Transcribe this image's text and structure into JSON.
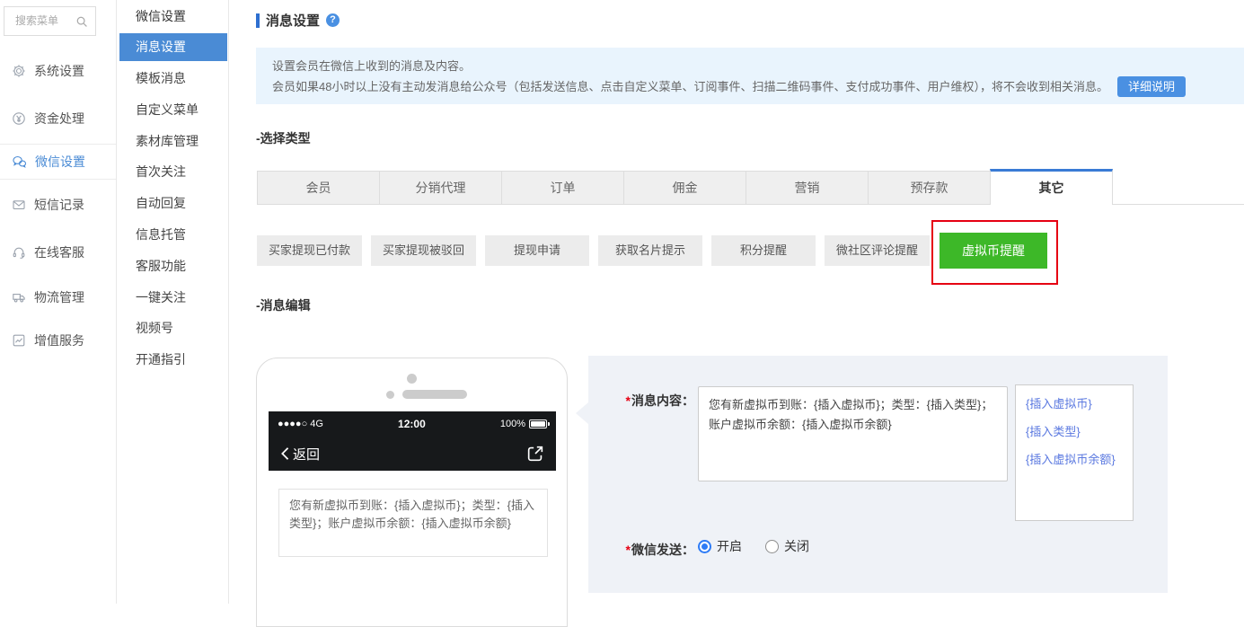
{
  "colors": {
    "accent_blue": "#4a8bd5",
    "tab_active_border": "#3a7bd5",
    "notice_bg": "#e9f4fd",
    "highlight_green": "#3db828",
    "annotation_red": "#e60012",
    "insert_link_blue": "#5b79e0"
  },
  "sidebar": {
    "search_placeholder": "搜索菜单",
    "items": [
      {
        "label": "系统设置",
        "icon": "gear-icon"
      },
      {
        "label": "资金处理",
        "icon": "yen-circle-icon"
      },
      {
        "label": "微信设置",
        "icon": "wechat-icon",
        "active": true
      },
      {
        "label": "短信记录",
        "icon": "envelope-icon"
      },
      {
        "label": "在线客服",
        "icon": "headset-icon"
      },
      {
        "label": "物流管理",
        "icon": "truck-icon"
      },
      {
        "label": "增值服务",
        "icon": "chart-icon"
      }
    ]
  },
  "submenu": {
    "title": "微信设置",
    "active_item": "消息设置",
    "items": [
      "消息设置",
      "模板消息",
      "自定义菜单",
      "素材库管理",
      "首次关注",
      "自动回复",
      "信息托管",
      "客服功能",
      "一键关注",
      "视频号",
      "开通指引"
    ]
  },
  "main": {
    "page_title": "消息设置",
    "help_icon_glyph": "?",
    "notice": {
      "line1": "设置会员在微信上收到的消息及内容。",
      "line2": "会员如果48小时以上没有主动发消息给公众号（包括发送信息、点击自定义菜单、订阅事件、扫描二维码事件、支付成功事件、用户维权），将不会收到相关消息。",
      "detail_button": "详细说明"
    },
    "select_type_label": "-选择类型",
    "tabs": [
      "会员",
      "分销代理",
      "订单",
      "佣金",
      "营销",
      "预存款",
      "其它"
    ],
    "active_tab": "其它",
    "type_buttons": [
      "买家提现已付款",
      "买家提现被驳回",
      "提现申请",
      "获取名片提示",
      "积分提醒",
      "微社区评论提醒"
    ],
    "highlighted_type_button": "虚拟币提醒",
    "message_edit_label": "-消息编辑"
  },
  "phone": {
    "status_signal": "●●●●○ 4G",
    "status_time": "12:00",
    "status_battery": "100%",
    "back_label": "返回",
    "preview_message": "您有新虚拟币到账：{插入虚拟币}；类型：{插入类型}；账户虚拟币余额：{插入虚拟币余额}"
  },
  "form": {
    "required_mark": "*",
    "message_content_label": "消息内容：",
    "message_content_value": "您有新虚拟币到账：{插入虚拟币}；类型：{插入类型}；账户虚拟币余额：{插入虚拟币余额}",
    "insert_links": [
      "{插入虚拟币}",
      "{插入类型}",
      "{插入虚拟币余额}"
    ],
    "wechat_send_label": "微信发送：",
    "option_on": "开启",
    "option_off": "关闭",
    "selected_option": "开启"
  }
}
